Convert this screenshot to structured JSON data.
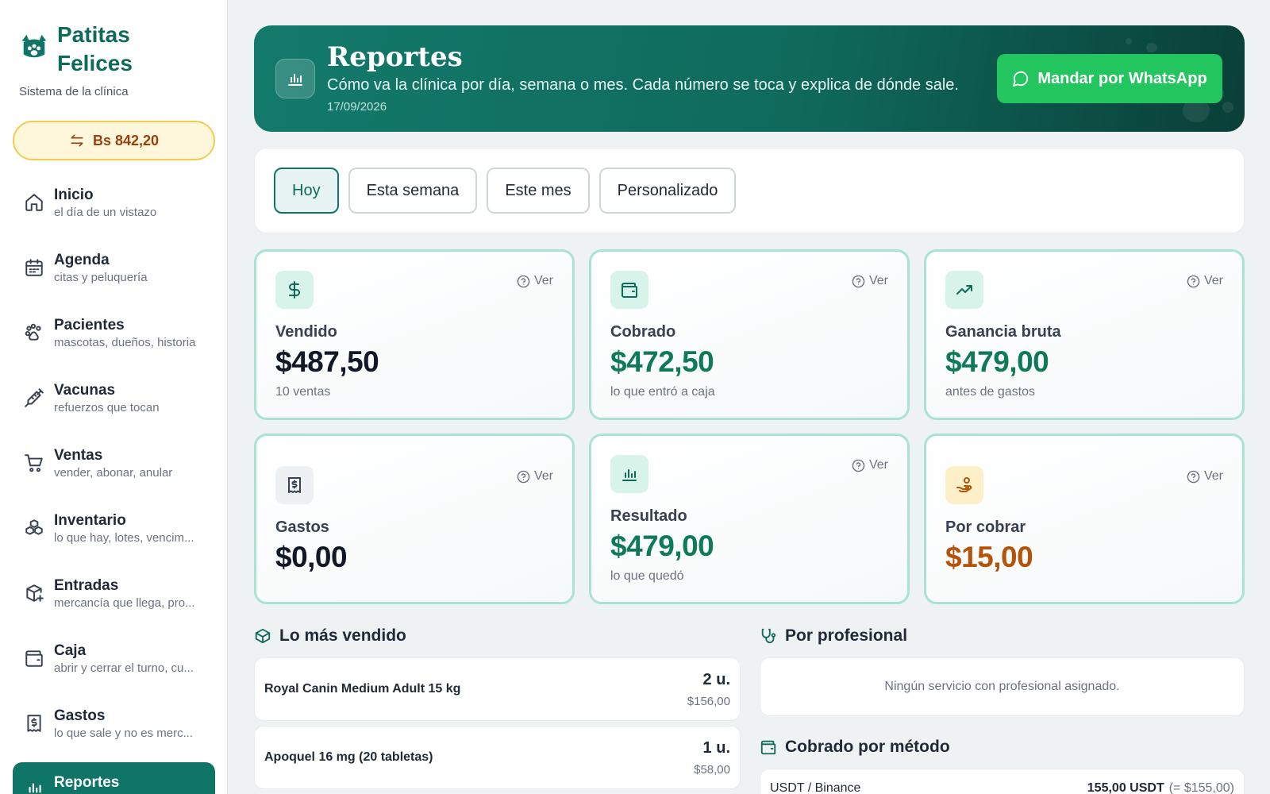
{
  "brand": {
    "name": "Patitas Felices",
    "subtitle": "Sistema de la clínica"
  },
  "exchange_rate": {
    "label": "Bs 842,20"
  },
  "nav": [
    {
      "title": "Inicio",
      "sub": "el día de un vistazo",
      "icon": "home-icon"
    },
    {
      "title": "Agenda",
      "sub": "citas y peluquería",
      "icon": "calendar-icon"
    },
    {
      "title": "Pacientes",
      "sub": "mascotas, dueños, historia",
      "icon": "paw-icon"
    },
    {
      "title": "Vacunas",
      "sub": "refuerzos que tocan",
      "icon": "syringe-icon"
    },
    {
      "title": "Ventas",
      "sub": "vender, abonar, anular",
      "icon": "cart-icon"
    },
    {
      "title": "Inventario",
      "sub": "lo que hay, lotes, vencim...",
      "icon": "boxes-icon"
    },
    {
      "title": "Entradas",
      "sub": "mercancía que llega, pro...",
      "icon": "package-plus-icon"
    },
    {
      "title": "Caja",
      "sub": "abrir y cerrar el turno, cu...",
      "icon": "wallet-icon"
    },
    {
      "title": "Gastos",
      "sub": "lo que sale y no es merc...",
      "icon": "receipt-icon"
    },
    {
      "title": "Reportes",
      "sub": "",
      "icon": "bar-chart-icon",
      "active": true
    }
  ],
  "header": {
    "title": "Reportes",
    "subtitle": "Cómo va la clínica por día, semana o mes. Cada número se toca y explica de dónde sale.",
    "date": "17/09/2026",
    "whatsapp_label": "Mandar por WhatsApp"
  },
  "periods": [
    {
      "label": "Hoy",
      "active": true
    },
    {
      "label": "Esta semana"
    },
    {
      "label": "Este mes"
    },
    {
      "label": "Personalizado"
    }
  ],
  "ver_label": "Ver",
  "metrics": {
    "vendido": {
      "label": "Vendido",
      "value": "$487,50",
      "note": "10 ventas"
    },
    "cobrado": {
      "label": "Cobrado",
      "value": "$472,50",
      "note": "lo que entró a caja"
    },
    "ganancia": {
      "label": "Ganancia bruta",
      "value": "$479,00",
      "note": "antes de gastos"
    },
    "gastos": {
      "label": "Gastos",
      "value": "$0,00"
    },
    "resultado": {
      "label": "Resultado",
      "value": "$479,00",
      "note": "lo que quedó"
    },
    "por_cobrar": {
      "label": "Por cobrar",
      "value": "$15,00"
    }
  },
  "top_sellers": {
    "title": "Lo más vendido",
    "items": [
      {
        "name": "Royal Canin Medium Adult 15 kg",
        "qty": "2 u.",
        "amount": "$156,00"
      },
      {
        "name": "Apoquel 16 mg (20 tabletas)",
        "qty": "1 u.",
        "amount": "$58,00"
      }
    ]
  },
  "by_professional": {
    "title": "Por profesional",
    "empty": "Ningún servicio con profesional asignado."
  },
  "by_method": {
    "title": "Cobrado por método",
    "items": [
      {
        "name": "USDT / Binance",
        "amount": "155,00 USDT",
        "equiv": "(= $155,00)"
      }
    ]
  },
  "colors": {
    "brand_teal": "#0f7567",
    "accent_green": "#0e7a57",
    "warning_orange": "#b45309",
    "whatsapp": "#22c55e",
    "card_border": "#a8e3d4"
  }
}
